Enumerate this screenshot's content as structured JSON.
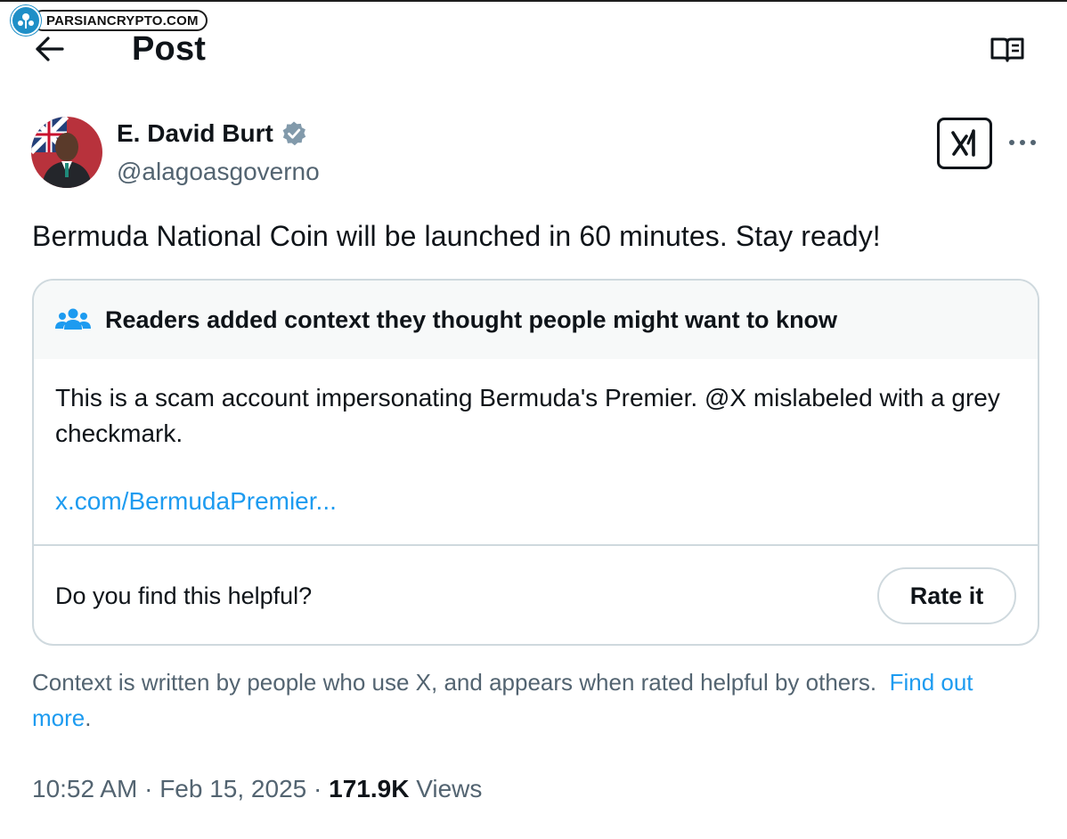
{
  "watermark": {
    "text": "PARSIANCRYPTO.COM"
  },
  "header": {
    "title": "Post"
  },
  "author": {
    "name": "E. David Burt",
    "handle": "@alagoasgoverno"
  },
  "post": {
    "text": "Bermuda National Coin will be launched in 60 minutes. Stay ready!",
    "time": "10:52 AM",
    "separator": "·",
    "date": "Feb 15, 2025",
    "views_count": "171.9K",
    "views_label": "Views"
  },
  "community_note": {
    "header": "Readers added context they thought people might want to know",
    "text": "This is a scam account impersonating Bermuda's Premier. @X mislabeled with a grey checkmark.",
    "link": "x.com/BermudaPremier...",
    "helpful_question": "Do you find this helpful?",
    "rate_label": "Rate it"
  },
  "context_disclaimer": {
    "text": "Context is written by people who use X, and appears when rated helpful by others.",
    "link": "Find out more",
    "period": "."
  },
  "colors": {
    "accent": "#1d9bf0",
    "secondary_text": "#536471",
    "border": "#cfd9de",
    "verified_badge": "#829aab"
  },
  "icons": [
    "back-arrow-icon",
    "reader-mode-icon",
    "verified-badge-icon",
    "grok-icon",
    "more-icon",
    "people-icon"
  ]
}
